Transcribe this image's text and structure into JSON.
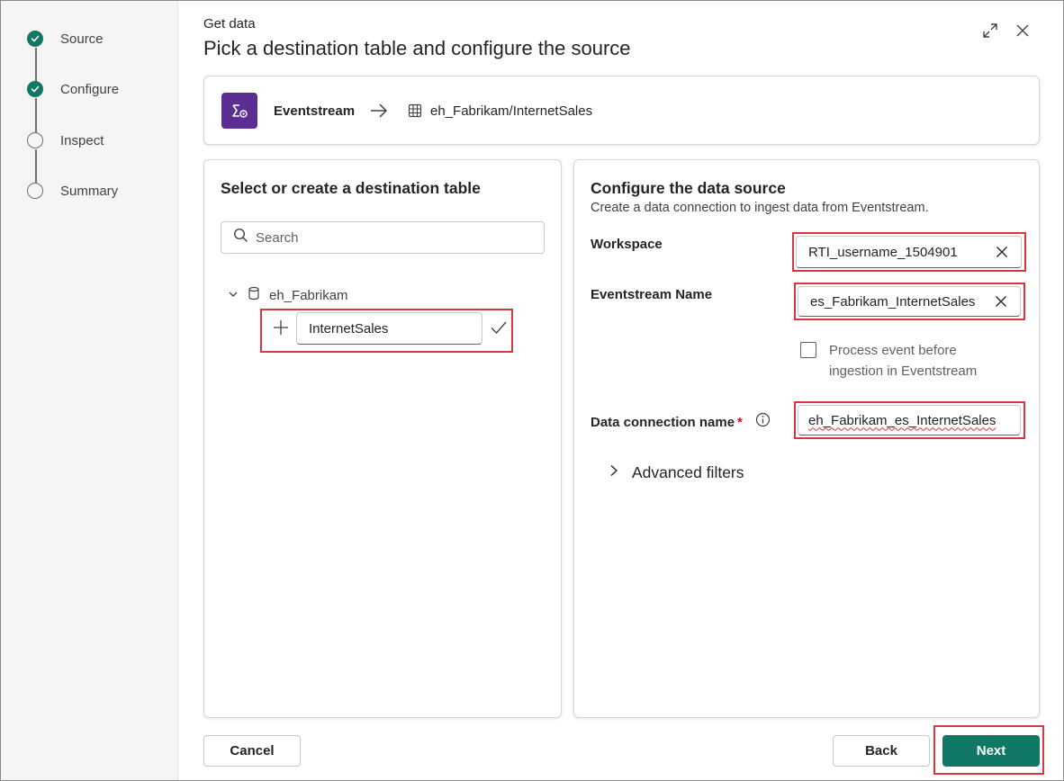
{
  "stepper": {
    "steps": [
      {
        "label": "Source",
        "state": "complete"
      },
      {
        "label": "Configure",
        "state": "complete"
      },
      {
        "label": "Inspect",
        "state": "pending"
      },
      {
        "label": "Summary",
        "state": "pending"
      }
    ]
  },
  "header": {
    "eyebrow": "Get data",
    "title": "Pick a destination table and configure the source",
    "icons": [
      "expand-icon",
      "close-icon"
    ]
  },
  "source_card": {
    "source_name": "Eventstream",
    "destination": "eh_Fabrikam/InternetSales",
    "icon_color": "#5b2f91"
  },
  "left_panel": {
    "title": "Select or create a destination table",
    "search_placeholder": "Search",
    "database": "eh_Fabrikam",
    "new_table_value": "InternetSales"
  },
  "right_panel": {
    "title": "Configure the data source",
    "subtitle": "Create a data connection to ingest data from Eventstream.",
    "workspace_label": "Workspace",
    "workspace_value": "RTI_username_1504901",
    "eventstream_label": "Eventstream Name",
    "eventstream_value": "es_Fabrikam_InternetSales",
    "process_checkbox_label": "Process event before ingestion in Eventstream",
    "process_checkbox_checked": false,
    "connection_label": "Data connection name",
    "required_mark": "*",
    "connection_value": "eh_Fabrikam_es_InternetSales",
    "advanced_label": "Advanced filters"
  },
  "footer": {
    "cancel_label": "Cancel",
    "back_label": "Back",
    "next_label": "Next"
  },
  "colors": {
    "accent": "#117865",
    "highlight": "#d9363e"
  }
}
